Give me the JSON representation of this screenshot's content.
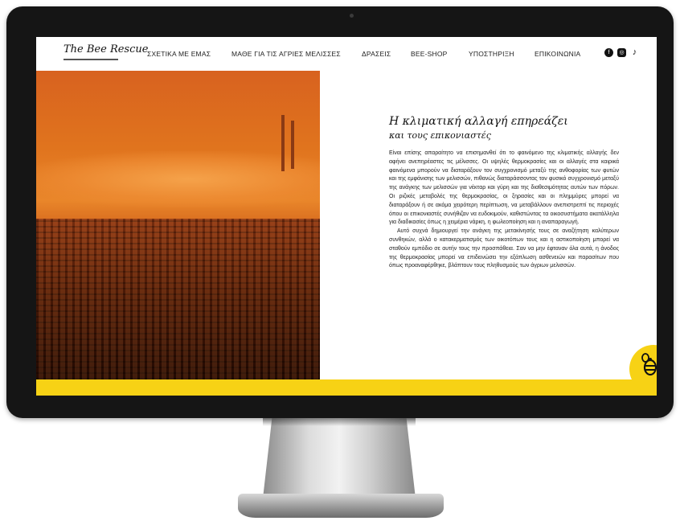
{
  "logo": {
    "text": "The Bee Rescue"
  },
  "nav": {
    "items": [
      "ΣΧΕΤΙΚΑ ΜΕ ΕΜΑΣ",
      "ΜΑΘΕ ΓΙΑ ΤΙΣ ΑΓΡΙΕΣ ΜΕΛΙΣΣΕΣ",
      "ΔΡΑΣΕΙΣ",
      "BEE-SHOP",
      "ΥΠΟΣΤΗΡΙΞΗ",
      "ΕΠΙΚΟΙΝΩΝΙΑ"
    ],
    "social_icons": [
      "facebook-icon",
      "instagram-icon",
      "tiktok-icon"
    ]
  },
  "article": {
    "title_line1": "Η κλιματική αλλαγή επηρεάζει",
    "title_line2": "και τους επικονιαστές",
    "paragraph1": "Είναι επίσης απαραίτητο να επισημανθεί ότι το φαινόμενο της κλιματικής αλλαγής δεν αφήνει ανεπηρέαστες τις μέλισσες. Οι υψηλές θερμοκρασίες και οι αλλαγές στα καιρικά φαινόμενα μπορούν να διαταράξουν τον συγχρονισμό μεταξύ της ανθοφορίας των φυτών και της εμφάνισης των μελισσών, πιθανώς διαταράσσοντας τον φυσικό συγχρονισμό μεταξύ της ανάγκης των μελισσών για νέκταρ και γύρη και της διαθεσιμότητας αυτών των πόρων. Οι ριζικές μεταβολές της θερμοκρασίας, οι ξηρασίες και οι πλημμύρες μπορεί να διαταράξουν ή σε ακόμα χειρότερη περίπτωση, να μεταβάλλουν ανεπιστρεπτί τις περιοχές όπου οι επικονιαστές συνήθιζαν να ευδοκιμούν, καθιστώντας τα οικοσυστήματα ακατάλληλα για διαδικασίες όπως η χειμέρια νάρκη, η φωλεοποίηση και η αναπαραγωγή.",
    "paragraph2": "Αυτό συχνά δημιουργεί την ανάγκη της μετακίνησής τους σε αναζήτηση καλύτερων συνθηκών, αλλά ο κατακερματισμός των οικοτόπων τους και η αστικοποίηση μπορεί να σταθούν εμπόδιο σε αυτήν τους την προσπάθεια. Σαν να μην έφταναν όλα αυτά, η άνοδος της θερμοκρασίας μπορεί να επιδεινώσει την εξάπλωση ασθενειών και παρασίτων που όπως προαναφέρθηκε, βλάπτουν τους πληθυσμούς των άγριων μελισσών."
  },
  "colors": {
    "accent_yellow": "#f7d215",
    "bezel": "#151515",
    "photo_orange": "#e0741e"
  },
  "footer": {
    "badge_icon": "bee-icon"
  }
}
